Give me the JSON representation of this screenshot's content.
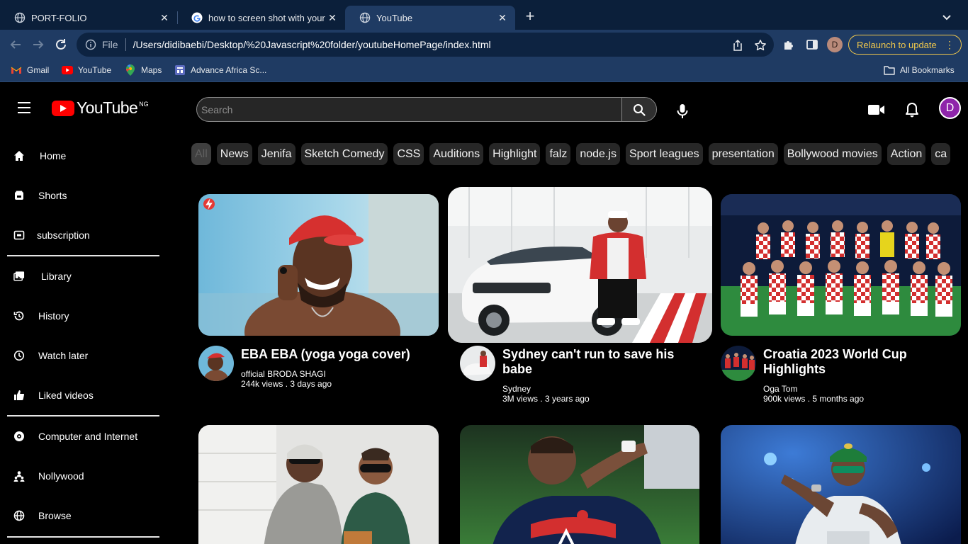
{
  "browser": {
    "tabs": [
      {
        "title": "PORT-FOLIO",
        "active": false,
        "icon": "globe-icon"
      },
      {
        "title": "how to screen shot with your r",
        "active": false,
        "icon": "google-icon"
      },
      {
        "title": "YouTube",
        "active": true,
        "icon": "globe-icon"
      }
    ],
    "address": {
      "scheme_label": "File",
      "url": "/Users/didibaebi/Desktop/%20Javascript%20folder/youtubeHomePage/index.html"
    },
    "profile_initial": "D",
    "relaunch_label": "Relaunch to update",
    "bookmarks": [
      {
        "label": "Gmail",
        "icon": "gmail-icon"
      },
      {
        "label": "YouTube",
        "icon": "youtube-icon"
      },
      {
        "label": "Maps",
        "icon": "maps-icon"
      },
      {
        "label": "Advance Africa Sc...",
        "icon": "site-icon"
      }
    ],
    "all_bookmarks_label": "All Bookmarks"
  },
  "youtube": {
    "logo_text": "YouTube",
    "country_code": "NG",
    "search_placeholder": "Search",
    "avatar_initial": "D",
    "brand_color": "#ff0000",
    "sidebar": {
      "items": [
        {
          "label": "Home",
          "icon": "home-icon"
        },
        {
          "label": "Shorts",
          "icon": "shorts-icon"
        },
        {
          "label": "subscription",
          "icon": "subscription-icon"
        },
        {
          "label": "Library",
          "icon": "library-icon"
        },
        {
          "label": "History",
          "icon": "history-icon"
        },
        {
          "label": "Watch later",
          "icon": "clock-icon"
        },
        {
          "label": "Liked videos",
          "icon": "thumbs-up-icon"
        },
        {
          "label": "Computer and Internet",
          "icon": "compass-icon"
        },
        {
          "label": "Nollywood",
          "icon": "people-icon"
        },
        {
          "label": "Browse",
          "icon": "globe-icon"
        }
      ]
    },
    "chips": [
      "All",
      "News",
      "Jenifa",
      "Sketch Comedy",
      "CSS",
      "Auditions",
      "Highlight",
      "falz",
      "node.js",
      "Sport leagues",
      "presentation",
      "Bollywood movies",
      "Action",
      "ca"
    ],
    "videos": [
      {
        "title": "EBA EBA (yoga yoga cover)",
        "channel": "official BRODA SHAGI",
        "meta": "244k views . 3 days ago"
      },
      {
        "title": "Sydney can't run to save his babe",
        "channel": "Sydney",
        "meta": "3M views . 3 years ago"
      },
      {
        "title": "Croatia 2023 World Cup Highlights",
        "channel": "Oga Tom",
        "meta": "900k views . 5 months ago"
      }
    ]
  }
}
